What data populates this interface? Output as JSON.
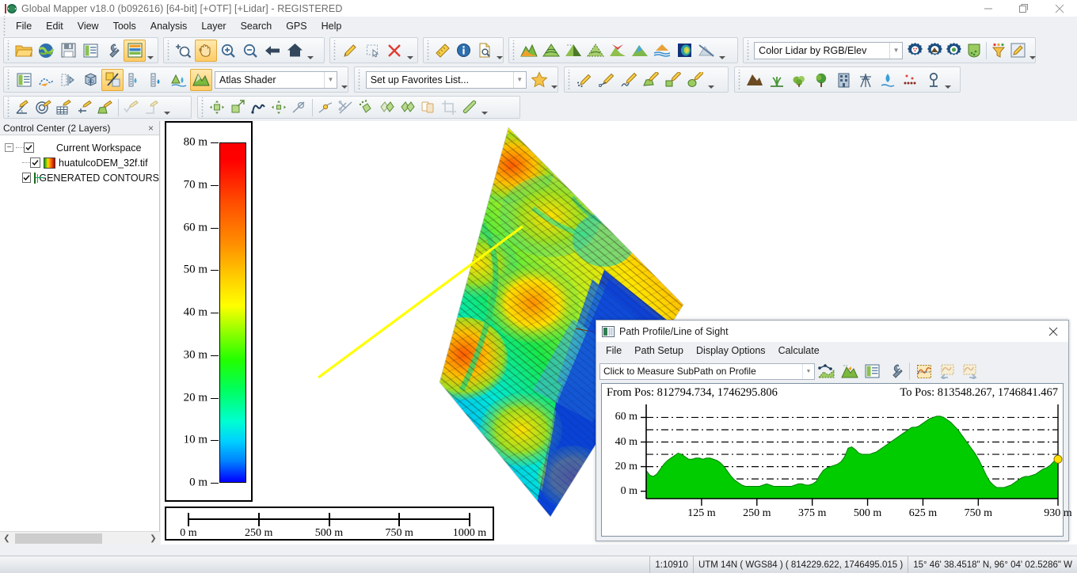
{
  "window": {
    "title": "Global Mapper v18.0 (b092616) [64-bit] [+OTF] [+Lidar] - REGISTERED",
    "minimize_label": "minimize",
    "maximize_label": "restore",
    "close_label": "close"
  },
  "menubar": {
    "items": [
      {
        "label": "File"
      },
      {
        "label": "Edit"
      },
      {
        "label": "View"
      },
      {
        "label": "Tools"
      },
      {
        "label": "Analysis"
      },
      {
        "label": "Layer"
      },
      {
        "label": "Search"
      },
      {
        "label": "GPS"
      },
      {
        "label": "Help"
      }
    ]
  },
  "toolbars": {
    "row1": {
      "file_group": [
        {
          "name": "open-file-icon",
          "label": "Open Data File"
        },
        {
          "name": "open-online-data-icon",
          "label": "Connect to Online Data"
        },
        {
          "name": "save-workspace-icon",
          "label": "Save Workspace"
        },
        {
          "name": "control-center-icon",
          "label": "Open Control Center"
        },
        {
          "name": "configure-icon",
          "label": "Configure"
        },
        {
          "name": "overlay-control-icon",
          "label": "Overlay Control Center"
        }
      ],
      "nav_group": [
        {
          "name": "zoom-select-icon",
          "label": "Zoom to Selection"
        },
        {
          "name": "pan-hand-icon",
          "label": "Pan Tool",
          "selected": true
        },
        {
          "name": "zoom-in-icon",
          "label": "Zoom In"
        },
        {
          "name": "zoom-out-icon",
          "label": "Zoom Out"
        },
        {
          "name": "previous-view-icon",
          "label": "Previous View"
        },
        {
          "name": "full-view-icon",
          "label": "Zoom to Full View"
        }
      ],
      "edit_group": [
        {
          "name": "digitizer-pencil-icon",
          "label": "Digitizer Tool"
        },
        {
          "name": "select-rect-icon",
          "label": "Feature Info Box"
        },
        {
          "name": "delete-red-x-icon",
          "label": "Delete Selected"
        }
      ],
      "measure_group": [
        {
          "name": "measure-ruler-icon",
          "label": "Measure Tool"
        },
        {
          "name": "feature-info-icon",
          "label": "Feature Info"
        },
        {
          "name": "search-layer-icon",
          "label": "Search by Attribute"
        }
      ],
      "shader_group": [
        {
          "name": "shader-atlas-icon",
          "label": "Atlas Shader"
        },
        {
          "name": "shader-contour-icon",
          "label": "Contour Shader"
        },
        {
          "name": "shader-daylight-icon",
          "label": "Daylight Shader"
        },
        {
          "name": "shader-gradient-icon",
          "label": "Gradient Shader"
        },
        {
          "name": "shader-colorramp-icon",
          "label": "Color Ramp Shader"
        },
        {
          "name": "shader-slope-icon",
          "label": "Slope Shader"
        },
        {
          "name": "shader-hsv-icon",
          "label": "HSV Shader"
        },
        {
          "name": "shader-global-icon",
          "label": "Global Shader"
        },
        {
          "name": "shader-none-icon",
          "label": "No Shader"
        }
      ],
      "lidar_combo": {
        "name": "lidar-draw-mode-combo",
        "value": "Color Lidar by RGB/Elev"
      },
      "lidar_group": [
        {
          "name": "lidar-classify-icon",
          "label": "Lidar Classification"
        },
        {
          "name": "lidar-ground-icon",
          "label": "Classify Ground Points"
        },
        {
          "name": "lidar-auto-icon",
          "label": "Auto Classify"
        },
        {
          "name": "lidar-paint-icon",
          "label": "Paint Lidar Points"
        },
        {
          "name": "lidar-filter-icon",
          "label": "Filter Lidar Points"
        },
        {
          "name": "lidar-eyedropper-icon",
          "label": "Pick Lidar Class"
        }
      ]
    },
    "row2": {
      "view_group": [
        {
          "name": "layer-panel-icon",
          "label": "Show/Hide Layer Panel"
        },
        {
          "name": "path-profile-icon",
          "label": "Path Profile/Line of Sight"
        },
        {
          "name": "view-shed-icon",
          "label": "View Shed Analysis"
        },
        {
          "name": "three-d-view-icon",
          "label": "3D View"
        },
        {
          "name": "cut-fill-icon",
          "label": "Cut-and-Fill Volumes",
          "selected": true
        },
        {
          "name": "water-level-icon",
          "label": "Water Level Rise"
        },
        {
          "name": "water-gauge-icon",
          "label": "Water Gauge"
        },
        {
          "name": "watershed-icon",
          "label": "Watershed Analysis"
        },
        {
          "name": "terrain-shader-icon",
          "label": "Terrain Shader",
          "selected": true
        }
      ],
      "shader_combo": {
        "name": "shader-select-combo",
        "value": "Atlas Shader"
      },
      "favorites_combo": {
        "name": "favorites-combo",
        "value": "Set up Favorites List..."
      },
      "favorites_star": {
        "name": "favorites-star-icon",
        "label": "Favorites"
      },
      "digitize_group": [
        {
          "name": "digitize-point-icon",
          "label": "Create New Point Feature"
        },
        {
          "name": "digitize-line-icon",
          "label": "Create New Line Feature"
        },
        {
          "name": "digitize-curve-icon",
          "label": "Create New Curved Line"
        },
        {
          "name": "digitize-area-icon",
          "label": "Create New Area Feature"
        },
        {
          "name": "digitize-rect-icon",
          "label": "Create New Rectangle"
        },
        {
          "name": "digitize-ellipse-icon",
          "label": "Create New Ellipse"
        }
      ],
      "feature_group": [
        {
          "name": "mountain-feature-icon",
          "label": "Mountain Feature"
        },
        {
          "name": "grass-feature-icon",
          "label": "Grass/Marsh Feature"
        },
        {
          "name": "shrub-feature-icon",
          "label": "Shrub Feature"
        },
        {
          "name": "tree-feature-icon",
          "label": "Tree Feature"
        },
        {
          "name": "building-feature-icon",
          "label": "Building Feature"
        },
        {
          "name": "power-line-icon",
          "label": "Power Line Feature"
        },
        {
          "name": "water-drop-icon",
          "label": "Water Feature"
        },
        {
          "name": "points-feature-icon",
          "label": "Point Cloud Feature"
        },
        {
          "name": "well-feature-icon",
          "label": "Well Feature"
        }
      ]
    },
    "row3": {
      "measure_group": [
        {
          "name": "measure-angle-icon",
          "label": "Measure Angle"
        },
        {
          "name": "measure-target-icon",
          "label": "Measure Target"
        },
        {
          "name": "measure-grid-icon",
          "label": "Measure Grid"
        },
        {
          "name": "measure-offset-icon",
          "label": "Measure Offset"
        },
        {
          "name": "measure-area-icon",
          "label": "Measure Area"
        },
        {
          "name": "apply-edit-icon",
          "label": "Apply Edit"
        },
        {
          "name": "snap-edit-icon",
          "label": "Snap Edit"
        }
      ],
      "transform_group": [
        {
          "name": "move-feature-icon",
          "label": "Move Feature"
        },
        {
          "name": "scale-feature-icon",
          "label": "Scale Feature"
        },
        {
          "name": "reshape-feature-icon",
          "label": "Reshape Feature"
        },
        {
          "name": "move-vertex-icon",
          "label": "Move Vertex"
        },
        {
          "name": "rotate-feature-icon",
          "label": "Rotate Feature"
        },
        {
          "name": "split-line-icon",
          "label": "Split Line at Vertex"
        },
        {
          "name": "cut-line-icon",
          "label": "Cut Line"
        },
        {
          "name": "combine-area-icon",
          "label": "Combine Areas"
        },
        {
          "name": "split-area-icon",
          "label": "Split Area"
        },
        {
          "name": "duplicate-area-icon",
          "label": "Duplicate Area"
        },
        {
          "name": "copy-area-icon",
          "label": "Copy Area"
        },
        {
          "name": "crop-area-icon",
          "label": "Crop to Area"
        },
        {
          "name": "measure-tape-icon",
          "label": "Measure Tape"
        }
      ]
    }
  },
  "sidebar": {
    "title": "Control Center (2 Layers)",
    "close_label": "×",
    "root": {
      "label": "Current Workspace",
      "checked": true,
      "expander": "−"
    },
    "layers": [
      {
        "label": "huatulcoDEM_32f.tif",
        "checked": true,
        "icon": "raster-layer-icon"
      },
      {
        "label": "GENERATED CONTOURS",
        "checked": true,
        "icon": "contour-layer-icon"
      }
    ]
  },
  "legend": {
    "name": "elevation-legend",
    "ticks": [
      "80 m",
      "70 m",
      "60 m",
      "50 m",
      "40 m",
      "30 m",
      "20 m",
      "10 m",
      "0 m"
    ],
    "min_value": 0,
    "max_value": 80,
    "unit": "m",
    "gradient_stops": [
      "#0000ff",
      "#00d0ff",
      "#00ff60",
      "#ffff00",
      "#ff9000",
      "#ff0000"
    ]
  },
  "scalebar": {
    "name": "map-scale-bar",
    "labels": [
      "0 m",
      "250 m",
      "500 m",
      "750 m",
      "1000 m"
    ]
  },
  "map": {
    "path_line_color": "#ffff00",
    "contour_color": "#7a3b10"
  },
  "dialog": {
    "title": "Path Profile/Line of Sight",
    "close_label": "✕",
    "menu": [
      {
        "label": "File"
      },
      {
        "label": "Path Setup"
      },
      {
        "label": "Display Options"
      },
      {
        "label": "Calculate"
      }
    ],
    "mode_combo": {
      "name": "subpath-measure-combo",
      "value": "Click to Measure SubPath on Profile"
    },
    "tools": [
      {
        "name": "profile-path-icon",
        "label": "Edit Path"
      },
      {
        "name": "profile-terrain-icon",
        "label": "Terrain Profile"
      },
      {
        "name": "profile-layout-icon",
        "label": "Profile Layout"
      },
      {
        "name": "profile-settings-icon",
        "label": "Profile Settings"
      },
      {
        "name": "profile-graph-icon",
        "label": "Show Graph"
      },
      {
        "name": "profile-prev-icon",
        "label": "Previous Path"
      },
      {
        "name": "profile-next-icon",
        "label": "Next Path"
      }
    ],
    "from_pos": "From Pos: 812794.734, 1746295.806",
    "to_pos": "To Pos: 813548.267, 1746841.467"
  },
  "chart_data": {
    "type": "area",
    "title": "Path Profile/Line of Sight elevation profile",
    "xlabel": "",
    "ylabel": "",
    "xlim": [
      0,
      930
    ],
    "ylim": [
      -6,
      68
    ],
    "grid": true,
    "grid_step": 10,
    "legend_position": "none",
    "yticks": [
      0,
      20,
      40,
      60
    ],
    "ytick_labels": [
      "0 m",
      "20 m",
      "40 m",
      "60 m"
    ],
    "xticks": [
      125,
      250,
      375,
      500,
      625,
      750,
      930
    ],
    "xtick_labels": [
      "125 m",
      "250 m",
      "375 m",
      "500 m",
      "625 m",
      "750 m",
      "930 m"
    ],
    "fill_color": "#00cc00",
    "line_color": "#008000",
    "end_marker_color": "#ffe000",
    "x": [
      0,
      8,
      16,
      24,
      32,
      40,
      48,
      56,
      64,
      72,
      80,
      88,
      96,
      104,
      112,
      120,
      128,
      136,
      144,
      152,
      160,
      168,
      176,
      184,
      192,
      200,
      208,
      216,
      224,
      232,
      240,
      248,
      256,
      264,
      272,
      280,
      288,
      296,
      304,
      312,
      320,
      328,
      336,
      344,
      352,
      360,
      368,
      376,
      384,
      392,
      400,
      408,
      416,
      424,
      432,
      440,
      448,
      456,
      464,
      472,
      480,
      488,
      496,
      504,
      512,
      520,
      528,
      536,
      544,
      552,
      560,
      568,
      576,
      584,
      592,
      600,
      608,
      616,
      624,
      632,
      640,
      648,
      656,
      664,
      672,
      680,
      688,
      696,
      704,
      712,
      720,
      728,
      736,
      744,
      752,
      760,
      768,
      776,
      784,
      792,
      800,
      808,
      816,
      824,
      832,
      840,
      848,
      856,
      864,
      872,
      880,
      888,
      896,
      904,
      912,
      920,
      930
    ],
    "y": [
      17,
      13,
      12,
      14,
      18,
      22,
      25,
      27,
      29,
      31,
      30,
      28,
      26,
      26,
      27,
      27,
      26,
      27,
      27,
      26,
      25,
      23,
      20,
      16,
      12,
      9,
      7,
      5,
      4,
      4,
      4,
      4,
      4,
      5,
      6,
      5,
      4,
      4,
      4,
      4,
      4,
      4,
      5,
      6,
      6,
      5,
      5,
      6,
      8,
      13,
      17,
      19,
      20,
      21,
      22,
      24,
      28,
      35,
      36,
      34,
      31,
      30,
      30,
      30,
      31,
      32,
      34,
      36,
      38,
      40,
      42,
      44,
      46,
      48,
      50,
      52,
      52,
      53,
      55,
      57,
      59,
      60,
      61,
      61,
      60,
      58,
      56,
      53,
      50,
      46,
      42,
      38,
      34,
      30,
      25,
      19,
      13,
      8,
      5,
      3,
      3,
      3,
      4,
      5,
      7,
      9,
      11,
      12,
      12,
      13,
      14,
      16,
      18,
      19,
      21,
      24,
      26
    ],
    "end_marker": {
      "x": 930,
      "y": 26
    }
  },
  "statusbar": {
    "scale": "1:10910",
    "projection": "UTM 14N ( WGS84 ) ( 814229.622, 1746495.015 )",
    "coordinates": "15° 46' 38.4518\" N, 96° 04' 02.5286\" W"
  }
}
